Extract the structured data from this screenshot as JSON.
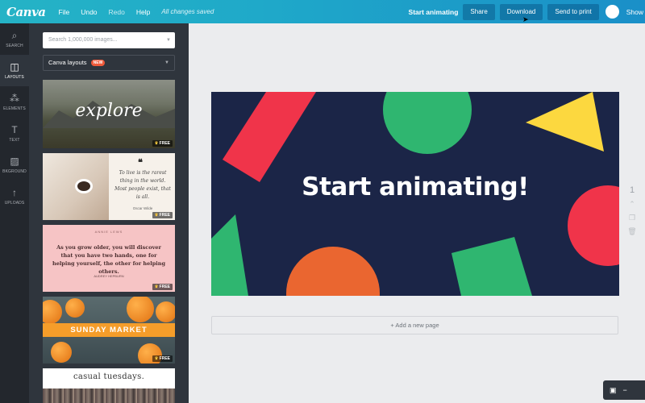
{
  "topbar": {
    "logo": "Canva",
    "menu": [
      "File",
      "Undo",
      "Redo",
      "Help"
    ],
    "saved_status": "All changes saved",
    "start_animating": "Start animating",
    "share": "Share",
    "download": "Download",
    "send_to_print": "Send to print",
    "show": "Show"
  },
  "rail": {
    "items": [
      {
        "label": "SEARCH",
        "icon": "search-icon"
      },
      {
        "label": "LAYOUTS",
        "icon": "layouts-icon"
      },
      {
        "label": "ELEMENTS",
        "icon": "elements-icon"
      },
      {
        "label": "TEXT",
        "icon": "text-icon"
      },
      {
        "label": "BKGROUND",
        "icon": "background-icon"
      },
      {
        "label": "UPLOADS",
        "icon": "upload-icon"
      }
    ],
    "active": "LAYOUTS"
  },
  "panel": {
    "search_placeholder": "Search 1,000,000 images...",
    "layouts_label": "Canva layouts",
    "new_badge": "NEW",
    "free_label": "FREE",
    "thumbnails": {
      "t1": {
        "text": "explore"
      },
      "t2": {
        "quote_mark": "❝",
        "quote": "To live is the rarest thing in the world. Most people exist, that is all.",
        "author": "Oscar Wilde"
      },
      "t3": {
        "small": "ANNIE LEWS",
        "body": "As you grow older, you will discover that you have two hands, one for helping yourself, the other for helping others.",
        "sig": "AUDREY HEPBURN"
      },
      "t4": {
        "text": "SUNDAY MARKET"
      },
      "t5": {
        "text": "casual tuesdays."
      }
    }
  },
  "design": {
    "headline": "Start animating!",
    "colors": {
      "background": "#1b2547",
      "red": "#f0344a",
      "green": "#2fb670",
      "yellow": "#fcd83f",
      "orange": "#ea6630"
    }
  },
  "add_page": "+ Add a new page",
  "page_number": "1"
}
